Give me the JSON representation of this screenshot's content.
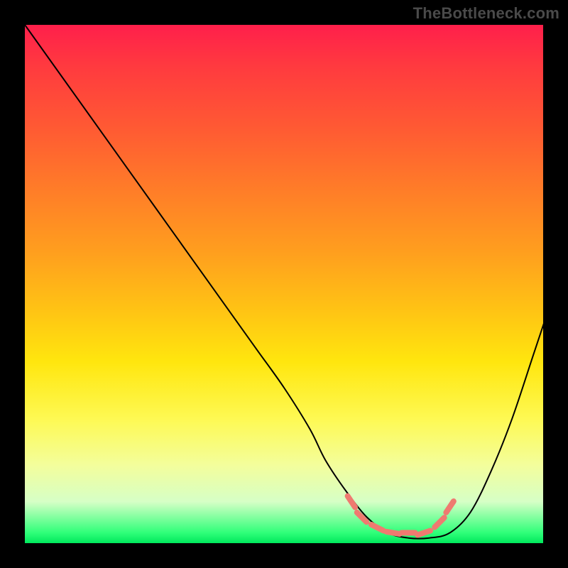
{
  "watermark": "TheBottleneck.com",
  "chart_data": {
    "type": "line",
    "title": "",
    "xlabel": "",
    "ylabel": "",
    "xlim": [
      0,
      100
    ],
    "ylim": [
      0,
      100
    ],
    "grid": false,
    "series": [
      {
        "name": "bottleneck-curve",
        "color": "#000000",
        "x": [
          0,
          5,
          10,
          15,
          20,
          25,
          30,
          35,
          40,
          45,
          50,
          55,
          58,
          62,
          66,
          70,
          74,
          78,
          82,
          86,
          90,
          94,
          98,
          100
        ],
        "y": [
          100,
          93,
          86,
          79,
          72,
          65,
          58,
          51,
          44,
          37,
          30,
          22,
          16,
          10,
          5,
          2,
          1,
          1,
          2,
          6,
          14,
          24,
          36,
          42
        ]
      }
    ],
    "markers": {
      "name": "optimal-range",
      "color": "#ef7a70",
      "x": [
        63,
        65,
        68,
        71,
        74,
        77,
        80,
        82
      ],
      "y": [
        8,
        5,
        3,
        2,
        2,
        2,
        4,
        7
      ]
    }
  }
}
